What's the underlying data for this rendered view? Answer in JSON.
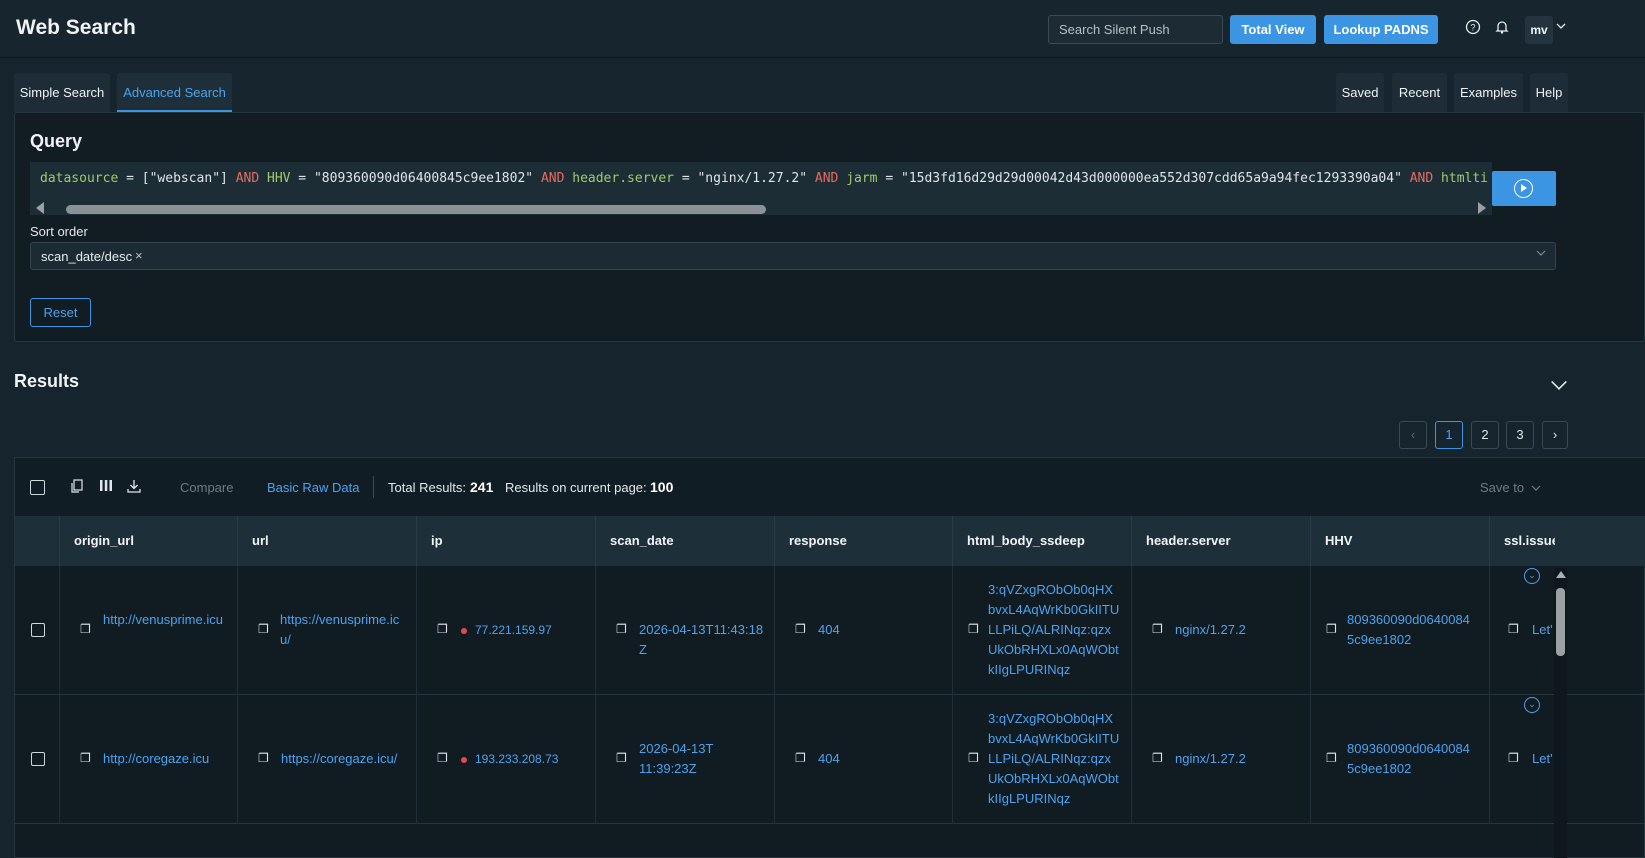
{
  "header": {
    "title": "Web Search",
    "search_placeholder": "Search Silent Push",
    "total_view_label": "Total View",
    "lookup_label": "Lookup PADNS",
    "avatar_initials": "mv"
  },
  "tabs": {
    "simple": "Simple Search",
    "advanced": "Advanced Search",
    "saved": "Saved",
    "recent": "Recent",
    "examples": "Examples",
    "help": "Help"
  },
  "query": {
    "title": "Query",
    "parts": {
      "f1": "datasource",
      "t1": " = [\"webscan\"] ",
      "op1": "AND",
      "f2": " HHV",
      "t2": " = \"809360090d06400845c9ee1802\" ",
      "op2": "AND",
      "f3": " header.server",
      "t3": " = \"nginx/1.27.2\" ",
      "op3": "AND",
      "f4": " jarm",
      "t4": " = \"15d3fd16d29d29d00042d43d000000ea552d307cdd65a9a94fec1293390a04\" ",
      "op4": "AND",
      "f5": " htmlti"
    },
    "sort_label": "Sort order",
    "sort_value": "scan_date/desc",
    "reset_label": "Reset"
  },
  "results": {
    "title": "Results",
    "pages": [
      "1",
      "2",
      "3"
    ],
    "compare_label": "Compare",
    "raw_label": "Basic Raw Data",
    "total_label": "Total Results:",
    "total_value": "241",
    "page_label": "Results on current page:",
    "page_value": "100",
    "save_to_label": "Save to",
    "columns": [
      "origin_url",
      "url",
      "ip",
      "scan_date",
      "response",
      "html_body_ssdeep",
      "header.server",
      "HHV",
      "ssl.issuer"
    ],
    "rows": [
      {
        "origin_url": "http://venusprime.icu",
        "url": "https://venusprime.icu/",
        "ip": "77.221.159.97",
        "scan_date": "2026-04-13T11:43:18Z",
        "response": "404",
        "ssdeep": "3:qVZxgRObOb0qHXbvxL4AqWrKb0GkIITULLPiLQ/ALRINqz:qzxUkObRHXLx0AqWObtkIIgLPURINqz",
        "server": "nginx/1.27.2",
        "hhv": "809360090d06400845c9ee1802",
        "issuer": "Let'"
      },
      {
        "origin_url": "http://coregaze.icu",
        "url": "https://coregaze.icu/",
        "ip": "193.233.208.73",
        "scan_date": "2026-04-13T11:39:23Z",
        "response": "404",
        "ssdeep": "3:qVZxgRObOb0qHXbvxL4AqWrKb0GkIITULLPiLQ/ALRINqz:qzxUkObRHXLx0AqWObtkIIgLPURINqz",
        "server": "nginx/1.27.2",
        "hhv": "809360090d06400845c9ee1802",
        "issuer": "Let'"
      }
    ]
  },
  "colors": {
    "accent": "#3b95e2",
    "background": "#16242d",
    "status_dot": "#e5484d"
  }
}
